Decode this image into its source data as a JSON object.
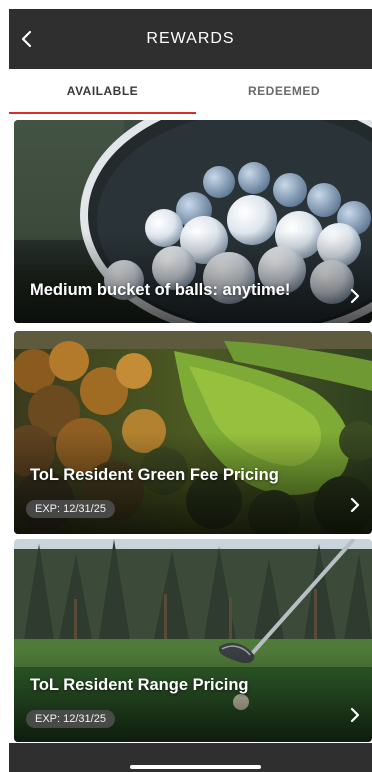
{
  "header": {
    "title": "REWARDS",
    "back_icon": "chevron-left-icon"
  },
  "tabs": [
    {
      "label": "AVAILABLE",
      "active": true
    },
    {
      "label": "REDEEMED",
      "active": false
    }
  ],
  "accent_color": "#d4302b",
  "rewards": [
    {
      "title": "Medium bucket of balls: anytime!",
      "expiry": ""
    },
    {
      "title": "ToL Resident Green Fee Pricing",
      "expiry": "EXP: 12/31/25"
    },
    {
      "title": "ToL Resident Range Pricing",
      "expiry": "EXP: 12/31/25"
    }
  ]
}
